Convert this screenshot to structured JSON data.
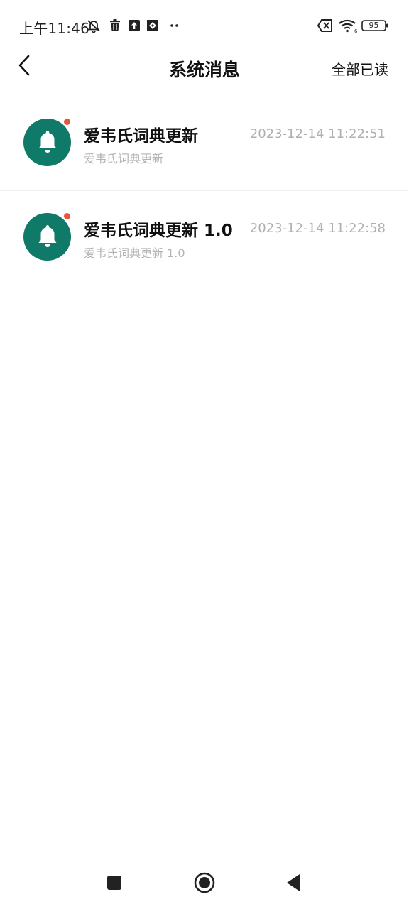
{
  "status_bar": {
    "time": "上午11:46",
    "battery": "95",
    "left_icons": [
      "muted-bell-icon",
      "trash-icon",
      "upload-icon",
      "app-icon",
      "more-dots-icon"
    ],
    "right_icons": [
      "sim-error-icon",
      "wifi-icon",
      "battery-icon"
    ]
  },
  "header": {
    "title": "系统消息",
    "action": "全部已读"
  },
  "messages": [
    {
      "title": "爱韦氏词典更新",
      "preview": "爱韦氏词典更新",
      "time": "2023-12-14 11:22:51",
      "unread": true
    },
    {
      "title": "爱韦氏词典更新 1.0",
      "preview": "爱韦氏词典更新 1.0",
      "time": "2023-12-14 11:22:58",
      "unread": true
    }
  ],
  "colors": {
    "avatar_bg": "#0f7a67",
    "unread_dot": "#e8553a",
    "muted_text": "#b0b0b0"
  },
  "nav_bar": {
    "buttons": [
      "recent-apps-button",
      "home-button",
      "back-nav-button"
    ]
  }
}
